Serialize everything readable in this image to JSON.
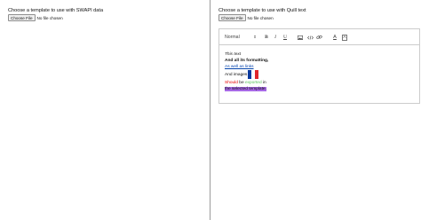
{
  "left_pane": {
    "prompt": "Choose a template to use with SWAPI data",
    "file_button": "Choose File",
    "file_status": "No file chosen"
  },
  "right_pane": {
    "prompt": "Choose a template to use with Quill text",
    "file_button": "Choose File",
    "file_status": "No file chosen",
    "toolbar": {
      "format_picker": "Normal",
      "format_picker_arrow": "⇕",
      "bold": "B",
      "italic": "I",
      "underline": "U",
      "image_icon": "image-icon",
      "code_icon": "code-icon",
      "link_icon": "link-icon",
      "text_color": "A",
      "background_color": "A"
    },
    "editor": {
      "line1": "This text",
      "line2": "And all its formatting,",
      "line3": "As well as links",
      "line4": "And images",
      "line5_part1": "Should",
      "line5_part2": " be ",
      "line5_part3": "exported",
      "line5_part4": " in",
      "line6": "the selected template.",
      "colors": {
        "link": "#0645ad",
        "red": "#e60000",
        "green": "#58c45a",
        "highlight": "#a769e6"
      }
    }
  }
}
